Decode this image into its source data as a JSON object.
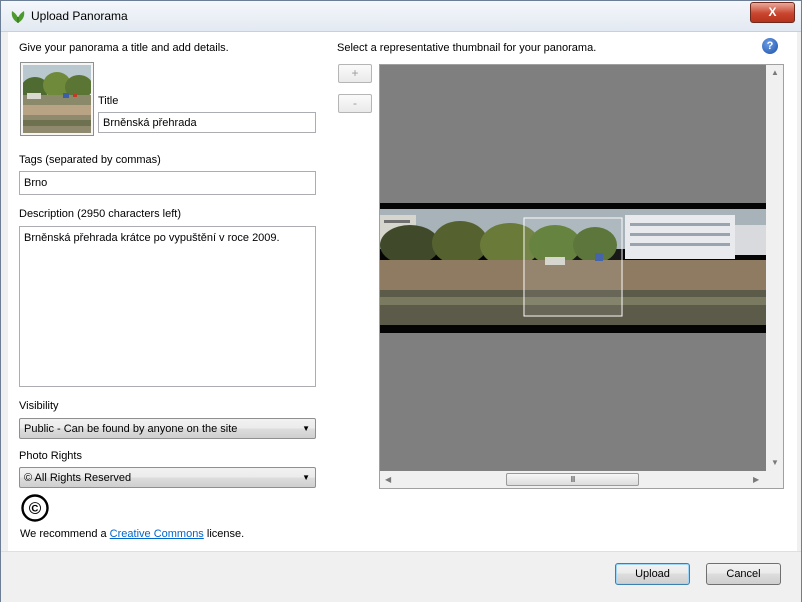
{
  "window": {
    "title": "Upload Panorama",
    "close_label": "X"
  },
  "left": {
    "heading": "Give your panorama a title and add details.",
    "title_label": "Title",
    "title_value": "Brněnská přehrada",
    "tags_label": "Tags (separated by commas)",
    "tags_value": "Brno",
    "description_label": "Description (2950 characters left)",
    "description_value": "Brněnská přehrada krátce po vypuštění v roce 2009.",
    "visibility_label": "Visibility",
    "visibility_value": "Public - Can be found by anyone on the site",
    "rights_label": "Photo Rights",
    "rights_value": "© All Rights Reserved",
    "cc_symbol": "©",
    "recommend_prefix": "We recommend a ",
    "recommend_link": "Creative Commons",
    "recommend_suffix": " license."
  },
  "right": {
    "heading": "Select a representative thumbnail for your panorama.",
    "help_icon": "?",
    "zoom_in_label": "+",
    "zoom_out_label": "-",
    "scroll_thumb_grip": "III"
  },
  "footer": {
    "upload_label": "Upload",
    "cancel_label": "Cancel"
  },
  "colors": {
    "link": "#0066cc",
    "preview_bg": "#7f7f7f",
    "close": "#c9452f"
  }
}
